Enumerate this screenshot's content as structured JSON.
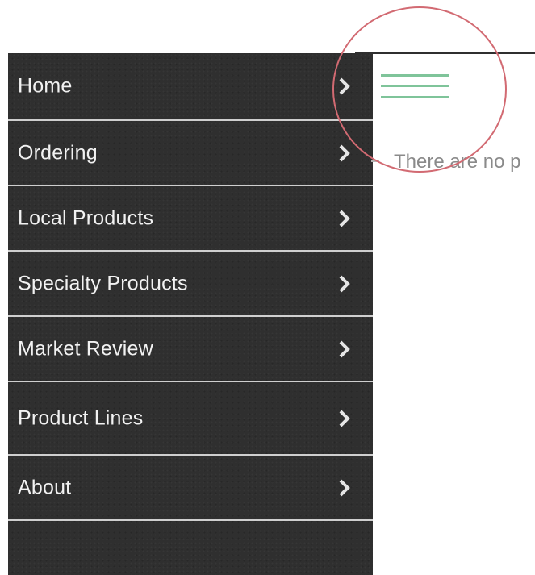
{
  "menu": {
    "items": [
      {
        "label": "Home"
      },
      {
        "label": "Ordering"
      },
      {
        "label": "Local Products"
      },
      {
        "label": "Specialty Products"
      },
      {
        "label": "Market Review"
      },
      {
        "label": "Product Lines"
      },
      {
        "label": "About"
      }
    ],
    "chevron_icon": "chevron-right-icon"
  },
  "content": {
    "empty_message": "There are no p"
  },
  "colors": {
    "drawer_background": "#2f2f2f",
    "menu_text": "#f2f2f2",
    "divider": "#cfcfcf",
    "hamburger": "#7fc49a",
    "annotation_circle": "#d26a72",
    "muted_text": "#8a8a8a"
  }
}
